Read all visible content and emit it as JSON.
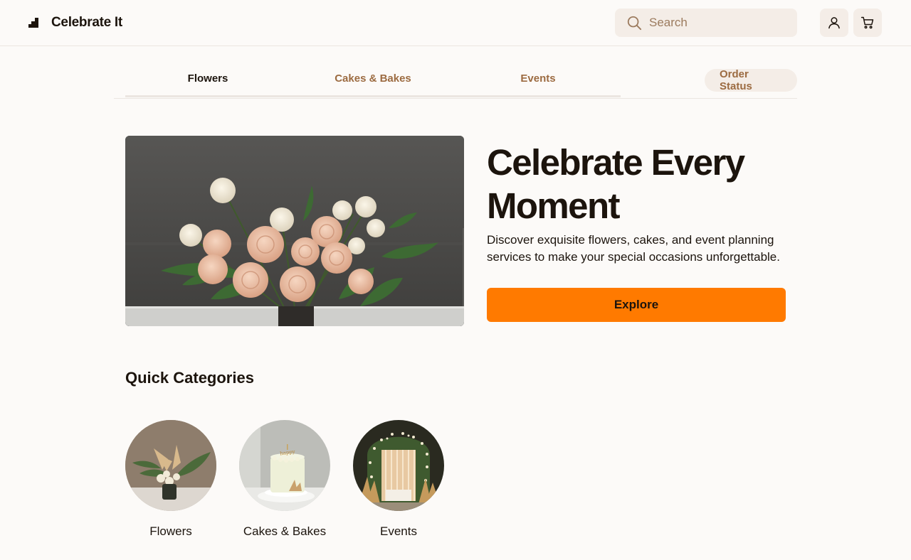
{
  "header": {
    "brand_name": "Celebrate It",
    "search_placeholder": "Search"
  },
  "tabs": [
    {
      "label": "Flowers",
      "active": true
    },
    {
      "label": "Cakes & Bakes",
      "active": false
    },
    {
      "label": "Events",
      "active": false
    }
  ],
  "order_status_label": "Order Status",
  "hero": {
    "title": "Celebrate Every Moment",
    "description": "Discover exquisite flowers, cakes, and event planning services to make your special occasions unforgettable.",
    "cta_label": "Explore"
  },
  "quick_categories": {
    "title": "Quick Categories",
    "items": [
      {
        "label": "Flowers"
      },
      {
        "label": "Cakes & Bakes"
      },
      {
        "label": "Events"
      }
    ]
  },
  "colors": {
    "background": "#fcfaf8",
    "accent": "#ff7a00",
    "muted_text": "#9c6b41",
    "chip_bg": "#f4ede7"
  },
  "icons": [
    "brand-logo-icon",
    "search-icon",
    "user-icon",
    "cart-icon"
  ]
}
